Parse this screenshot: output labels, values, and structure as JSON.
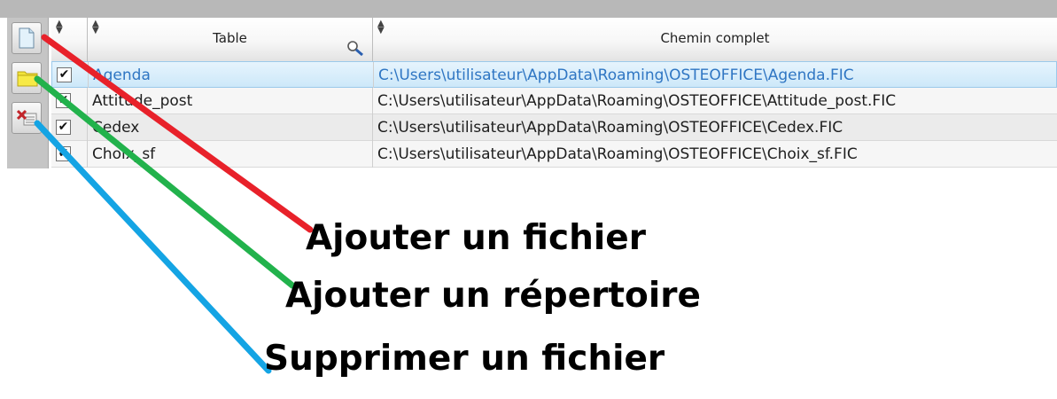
{
  "toolbar": {
    "buttons": [
      {
        "icon": "new-file-icon",
        "tooltip": ""
      },
      {
        "icon": "folder-icon",
        "tooltip": ""
      },
      {
        "icon": "delete-file-icon",
        "tooltip": ""
      }
    ]
  },
  "table": {
    "columns": [
      "",
      "Table",
      "Chemin complet"
    ],
    "rows": [
      {
        "checked": true,
        "name": "Agenda",
        "path": "C:\\Users\\utilisateur\\AppData\\Roaming\\OSTEOFFICE\\Agenda.FIC",
        "selected": true
      },
      {
        "checked": true,
        "name": "Attitude_post",
        "path": "C:\\Users\\utilisateur\\AppData\\Roaming\\OSTEOFFICE\\Attitude_post.FIC",
        "selected": false
      },
      {
        "checked": true,
        "name": "Cedex",
        "path": "C:\\Users\\utilisateur\\AppData\\Roaming\\OSTEOFFICE\\Cedex.FIC",
        "selected": false
      },
      {
        "checked": true,
        "name": "Choix_sf",
        "path": "C:\\Users\\utilisateur\\AppData\\Roaming\\OSTEOFFICE\\Choix_sf.FIC",
        "selected": false
      }
    ]
  },
  "annotations": {
    "add_file": "Ajouter un fichier",
    "add_directory": "Ajouter un répertoire",
    "delete_file": "Supprimer un fichier",
    "colors": {
      "add_file": "#e8212a",
      "add_directory": "#22b24c",
      "delete_file": "#14a4e4"
    }
  }
}
